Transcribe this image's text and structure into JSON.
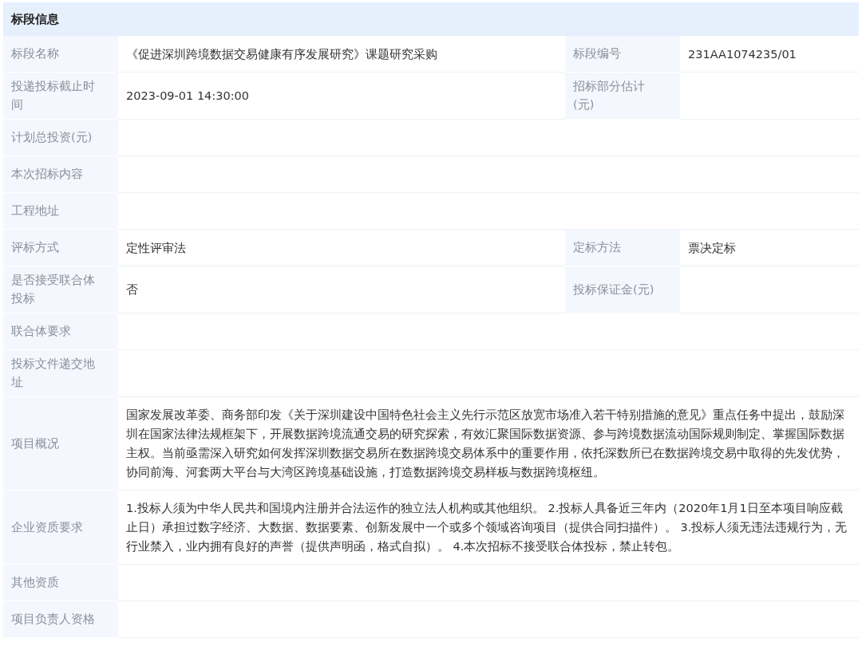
{
  "section_title": "标段信息",
  "rows": [
    {
      "fields": [
        {
          "label": "标段名称",
          "value": "《促进深圳跨境数据交易健康有序发展研究》课题研究采购"
        },
        {
          "label": "标段编号",
          "value": "231AA1074235/01"
        }
      ]
    },
    {
      "fields": [
        {
          "label": "投递投标截止时间",
          "value": "2023-09-01 14:30:00"
        },
        {
          "label": "招标部分估计(元)"
        }
      ]
    },
    {
      "fields": [
        {
          "label": "计划总投资(元)"
        }
      ]
    },
    {
      "fields": [
        {
          "label": "本次招标内容"
        }
      ]
    },
    {
      "fields": [
        {
          "label": "工程地址"
        }
      ]
    },
    {
      "fields": [
        {
          "label": "评标方式",
          "value": "定性评审法"
        },
        {
          "label": "定标方法",
          "value": "票决定标"
        }
      ]
    },
    {
      "fields": [
        {
          "label": "是否接受联合体投标",
          "value": "否"
        },
        {
          "label": "投标保证金(元)"
        }
      ]
    },
    {
      "fields": [
        {
          "label": "联合体要求"
        }
      ]
    },
    {
      "fields": [
        {
          "label": "投标文件递交地址"
        }
      ]
    },
    {
      "fields": [
        {
          "label": "项目概况",
          "value": "国家发展改革委、商务部印发《关于深圳建设中国特色社会主义先行示范区放宽市场准入若干特别措施的意见》重点任务中提出，鼓励深圳在国家法律法规框架下，开展数据跨境流通交易的研究探索，有效汇聚国际数据资源、参与跨境数据流动国际规则制定、掌握国际数据主权。当前亟需深入研究如何发挥深圳数据交易所在数据跨境交易体系中的重要作用，依托深数所已在数据跨境交易中取得的先发优势，协同前海、河套两大平台与大湾区跨境基础设施，打造数据跨境交易样板与数据跨境枢纽。"
        }
      ]
    },
    {
      "fields": [
        {
          "label": "企业资质要求",
          "value": "1.投标人须为中华人民共和国境内注册并合法运作的独立法人机构或其他组织。 2.投标人具备近三年内（2020年1月1日至本项目响应截止日）承担过数字经济、大数据、数据要素、创新发展中一个或多个领域咨询项目（提供合同扫描件）。 3.投标人须无违法违规行为，无行业禁入，业内拥有良好的声誉（提供声明函，格式自拟）。 4.本次招标不接受联合体投标，禁止转包。"
        }
      ]
    },
    {
      "fields": [
        {
          "label": "其他资质"
        }
      ]
    },
    {
      "fields": [
        {
          "label": "项目负责人资格"
        }
      ]
    }
  ]
}
